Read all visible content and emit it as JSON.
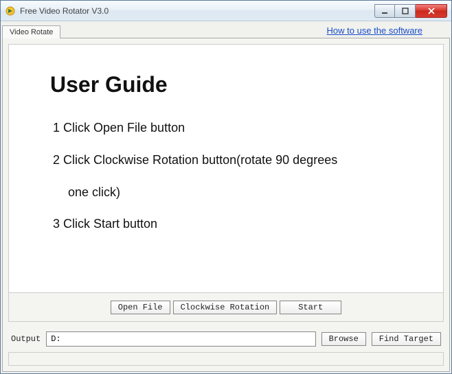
{
  "window": {
    "title": "Free Video Rotator V3.0"
  },
  "tabs": {
    "rotate": "Video Rotate"
  },
  "help_link": "How to use the software",
  "guide": {
    "heading": "User Guide",
    "step1": "1 Click Open File button",
    "step2a": "2 Click Clockwise Rotation button(rotate 90 degrees",
    "step2b": "one click)",
    "step3": "3 Click Start button"
  },
  "buttons": {
    "open_file": "Open File",
    "clockwise": "Clockwise Rotation",
    "start": "Start",
    "browse": "Browse",
    "find_target": "Find Target"
  },
  "output": {
    "label": "Output",
    "value": "D:"
  }
}
